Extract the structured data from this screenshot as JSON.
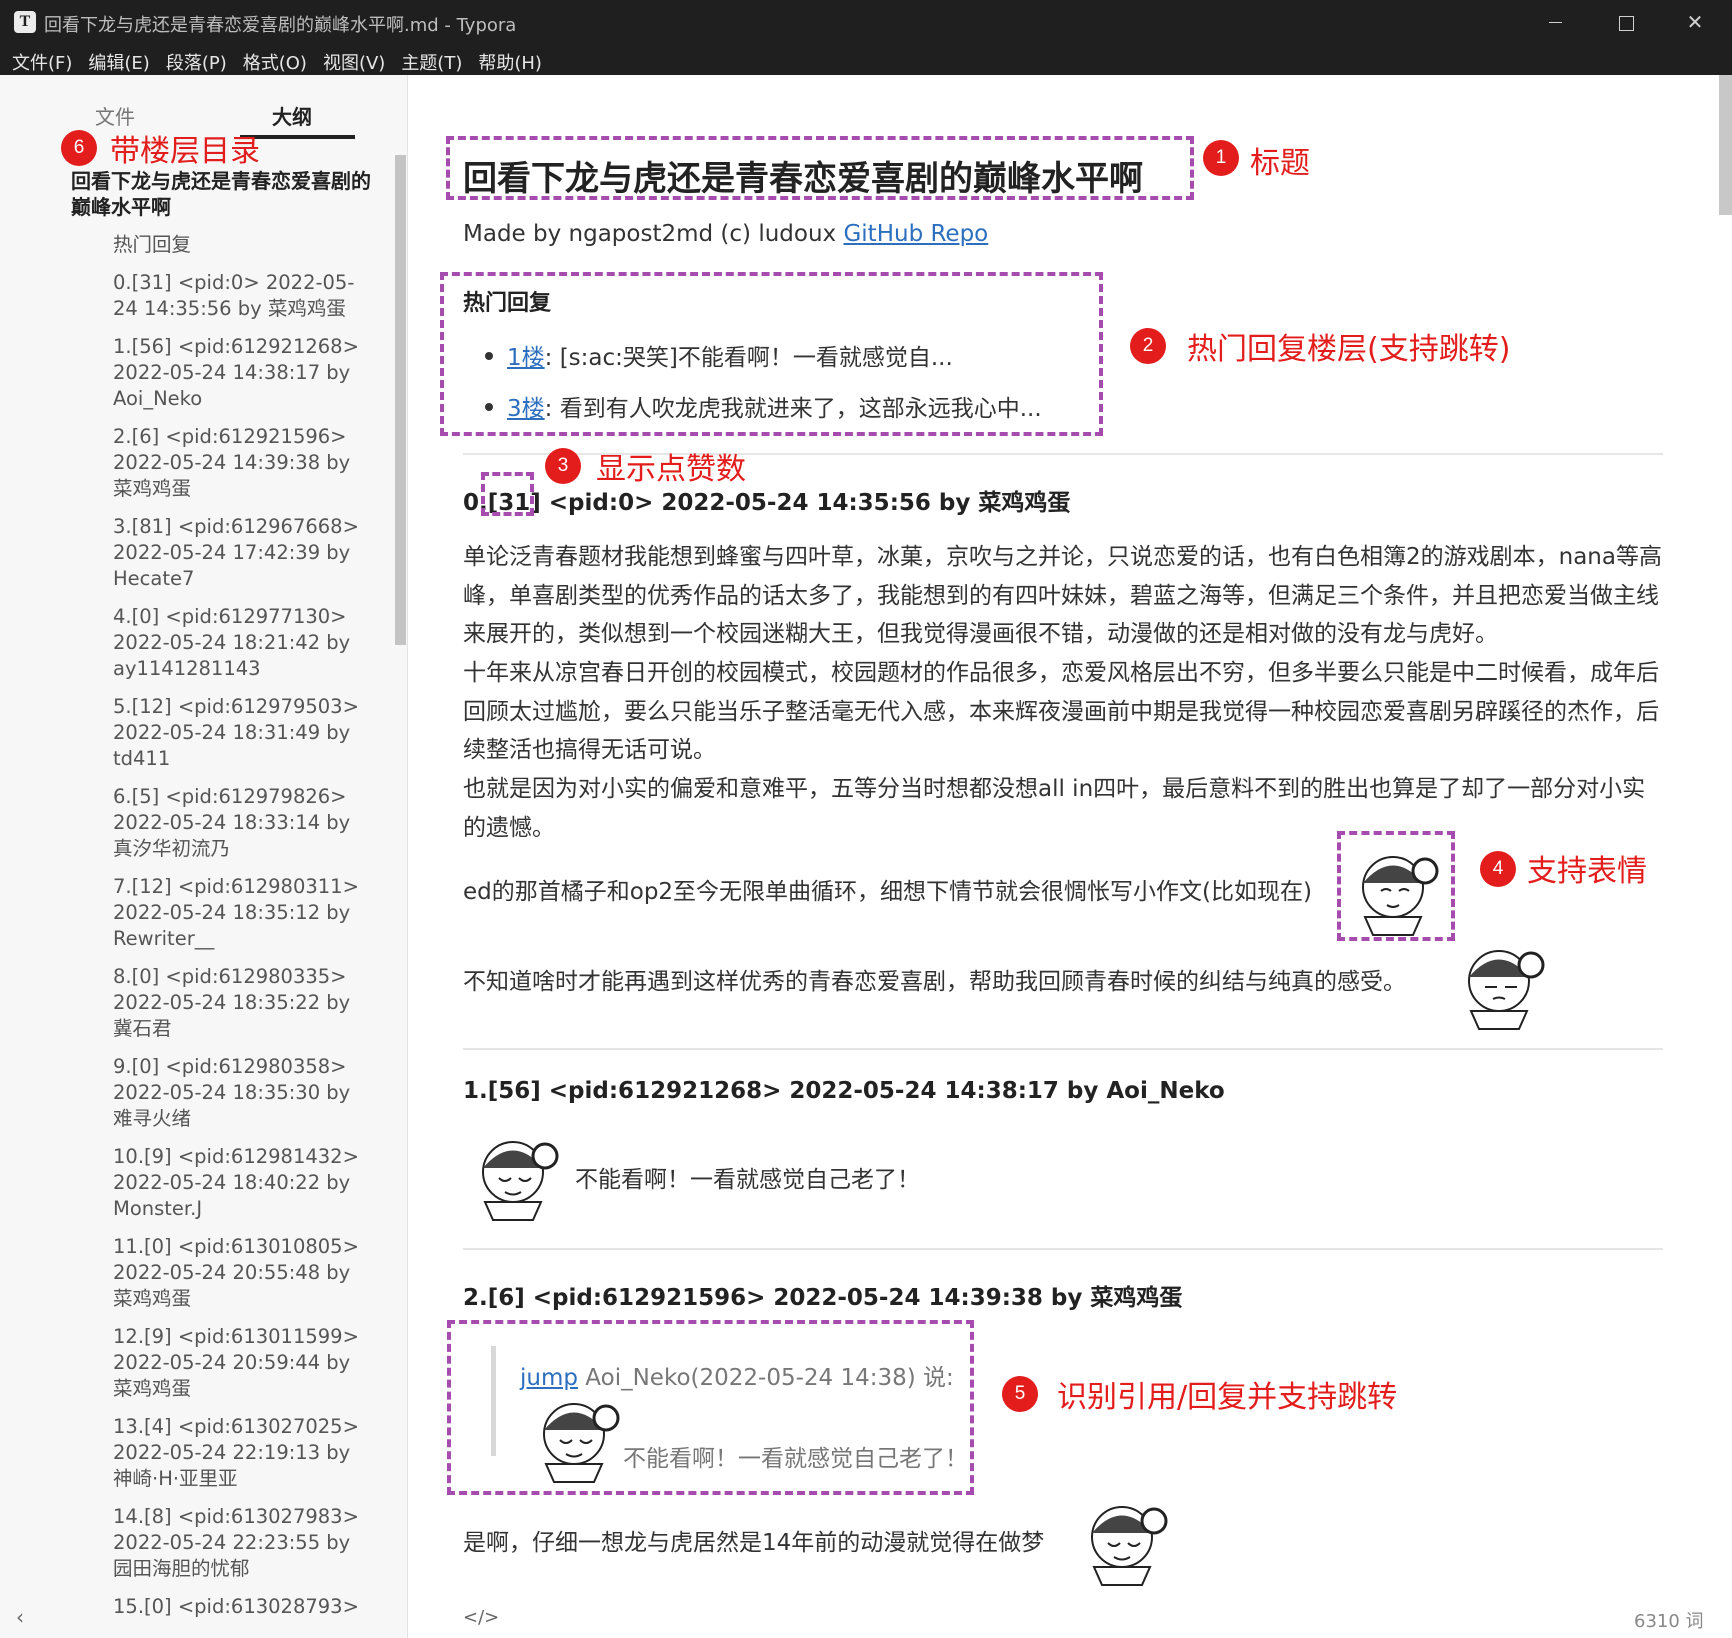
{
  "window": {
    "app_icon": "T",
    "title": "回看下龙与虎还是青春恋爱喜剧的巅峰水平啊.md - Typora",
    "minimize_icon": "minimize-icon",
    "maximize_icon": "maximize-icon",
    "close_icon": "close-icon",
    "close_glyph": "✕"
  },
  "menu": [
    "文件(F)",
    "编辑(E)",
    "段落(P)",
    "格式(O)",
    "视图(V)",
    "主题(T)",
    "帮助(H)"
  ],
  "sidebar": {
    "tab_file": "文件",
    "tab_outline": "大纲",
    "outline_title": "回看下龙与虎还是青春恋爱喜剧的巅峰水平啊",
    "items": [
      "热门回复",
      "0.[31] <pid:0> 2022-05-24 14:35:56 by 菜鸡鸡蛋",
      "1.[56] <pid:612921268> 2022-05-24 14:38:17 by Aoi_Neko",
      "2.[6] <pid:612921596> 2022-05-24 14:39:38 by 菜鸡鸡蛋",
      "3.[81] <pid:612967668> 2022-05-24 17:42:39 by Hecate7",
      "4.[0] <pid:612977130> 2022-05-24 18:21:42 by ay1141281143",
      "5.[12] <pid:612979503> 2022-05-24 18:31:49 by td411",
      "6.[5] <pid:612979826> 2022-05-24 18:33:14 by 真汐华初流乃",
      "7.[12] <pid:612980311> 2022-05-24 18:35:12 by Rewriter__",
      "8.[0] <pid:612980335> 2022-05-24 18:35:22 by 冀石君",
      "9.[0] <pid:612980358> 2022-05-24 18:35:30 by 难寻火绪",
      "10.[9] <pid:612981432> 2022-05-24 18:40:22 by Monster.J",
      "11.[0] <pid:613010805> 2022-05-24 20:55:48 by 菜鸡鸡蛋",
      "12.[9] <pid:613011599> 2022-05-24 20:59:44 by 菜鸡鸡蛋",
      "13.[4] <pid:613027025> 2022-05-24 22:19:13 by 神崎·H·亚里亚",
      "14.[8] <pid:613027983> 2022-05-24 22:23:55 by 园田海胆的忧郁",
      "15.[0] <pid:613028793>"
    ]
  },
  "doc": {
    "title": "回看下龙与虎还是青春恋爱喜剧的巅峰水平啊",
    "madeby_prefix": "Made by ngapost2md (c) ludoux ",
    "madeby_link": "GitHub Repo",
    "hot_heading": "热门回复",
    "hot_items": [
      {
        "link": "1楼",
        "text": ": [s:ac:哭笑]不能看啊！一看就感觉自..."
      },
      {
        "link": "3楼",
        "text": ": 看到有人吹龙虎我就进来了，这部永远我心中..."
      }
    ],
    "post0": {
      "prefix": "0.",
      "likes": "[31]",
      "rest": " <pid:0> 2022-05-24 14:35:56 by 菜鸡鸡蛋",
      "para1": "单论泛青春题材我能想到蜂蜜与四叶草，冰菓，京吹与之并论，只说恋爱的话，也有白色相簿2的游戏剧本，nana等高峰，单喜剧类型的优秀作品的话太多了，我能想到的有四叶妹妹，碧蓝之海等，但满足三个条件，并且把恋爱当做主线来展开的，类似想到一个校园迷糊大王，但我觉得漫画很不错，动漫做的还是相对做的没有龙与虎好。",
      "para2": "十年来从凉宫春日开创的校园模式，校园题材的作品很多，恋爱风格层出不穷，但多半要么只能是中二时候看，成年后回顾太过尴尬，要么只能当乐子整活毫无代入感，本来辉夜漫画前中期是我觉得一种校园恋爱喜剧另辟蹊径的杰作，后续整活也搞得无话可说。",
      "para3": "也就是因为对小实的偏爱和意难平，五等分当时想都没想all in四叶，最后意料不到的胜出也算是了却了一部分对小实的遗憾。",
      "line4": "ed的那首橘子和op2至今无限单曲循环，细想下情节就会很惆怅写小作文(比如现在)",
      "line5": "不知道啥时才能再遇到这样优秀的青春恋爱喜剧，帮助我回顾青春时候的纠结与纯真的感受。"
    },
    "post1": {
      "head": "1.[56] <pid:612921268> 2022-05-24 14:38:17 by Aoi_Neko",
      "text": "不能看啊！一看就感觉自己老了！"
    },
    "post2": {
      "head": "2.[6] <pid:612921596> 2022-05-24 14:39:38 by 菜鸡鸡蛋",
      "quote_link": "jump",
      "quote_who": " Aoi_Neko(2022-05-24 14:38) 说:",
      "quote_text": "不能看啊！一看就感觉自己老了！",
      "reply": "是啊，仔细一想龙与虎居然是14年前的动漫就觉得在做梦"
    }
  },
  "status": {
    "back_glyph": "‹",
    "code_glyph": "</>",
    "word_count": "6310 词"
  },
  "annotations": [
    {
      "num": "1",
      "label": "标题"
    },
    {
      "num": "2",
      "label": "热门回复楼层(支持跳转)"
    },
    {
      "num": "3",
      "label": "显示点赞数"
    },
    {
      "num": "4",
      "label": "支持表情"
    },
    {
      "num": "5",
      "label": "识别引用/回复并支持跳转"
    },
    {
      "num": "6",
      "label": "带楼层目录"
    }
  ],
  "colors": {
    "annotation_red": "#e31c1c",
    "dash_purple": "#a64cae",
    "link_blue": "#2c6fbf",
    "titlebar": "#1f1f1f"
  }
}
